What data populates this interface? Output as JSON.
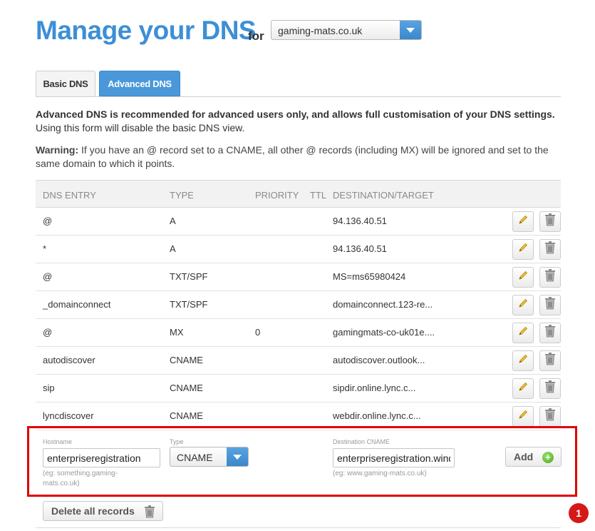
{
  "header": {
    "title": "Manage your DNS",
    "for_label": "for",
    "domain": "gaming-mats.co.uk"
  },
  "tabs": [
    {
      "label": "Basic DNS",
      "active": false
    },
    {
      "label": "Advanced DNS",
      "active": true
    }
  ],
  "intro": {
    "bold": "Advanced DNS is recommended for advanced users only, and allows full customisation of your DNS settings.",
    "normal": "Using this form will disable the basic DNS view.",
    "warning_label": "Warning:",
    "warning_text": "If you have an @ record set to a CNAME, all other @ records (including MX) will be ignored and set to the same domain to which it points."
  },
  "table": {
    "columns": [
      "DNS ENTRY",
      "TYPE",
      "PRIORITY",
      "TTL",
      "DESTINATION/TARGET"
    ],
    "rows": [
      {
        "entry": "@",
        "type": "A",
        "priority": "",
        "ttl": "",
        "destination": "94.136.40.51"
      },
      {
        "entry": "*",
        "type": "A",
        "priority": "",
        "ttl": "",
        "destination": "94.136.40.51"
      },
      {
        "entry": "@",
        "type": "TXT/SPF",
        "priority": "",
        "ttl": "",
        "destination": "MS=ms65980424"
      },
      {
        "entry": "_domainconnect",
        "type": "TXT/SPF",
        "priority": "",
        "ttl": "",
        "destination": "domainconnect.123-re..."
      },
      {
        "entry": "@",
        "type": "MX",
        "priority": "0",
        "ttl": "",
        "destination": "gamingmats-co-uk01e...."
      },
      {
        "entry": "autodiscover",
        "type": "CNAME",
        "priority": "",
        "ttl": "",
        "destination": "autodiscover.outlook..."
      },
      {
        "entry": "sip",
        "type": "CNAME",
        "priority": "",
        "ttl": "",
        "destination": "sipdir.online.lync.c..."
      },
      {
        "entry": "lyncdiscover",
        "type": "CNAME",
        "priority": "",
        "ttl": "",
        "destination": "webdir.online.lync.c..."
      }
    ]
  },
  "add_form": {
    "hostname_label": "Hostname",
    "hostname_value": "enterpriseregistration",
    "hostname_hint": "(eg: something.gaming-mats.co.uk)",
    "type_label": "Type",
    "type_value": "CNAME",
    "dest_label": "Destination CNAME",
    "dest_value": "enterpriseregistration.windows.net",
    "dest_hint": "(eg: www.gaming-mats.co.uk)",
    "add_label": "Add"
  },
  "delete_all_label": "Delete all records",
  "annotation_marker": "1",
  "colors": {
    "accent": "#3d8fd6",
    "highlight_border": "#e00000",
    "marker": "#d61818",
    "add_green": "#4aa81e"
  },
  "icons": {
    "edit": "pencil-icon",
    "delete": "trash-icon",
    "add": "plus-circle-icon",
    "dropdown": "chevron-down-icon"
  }
}
